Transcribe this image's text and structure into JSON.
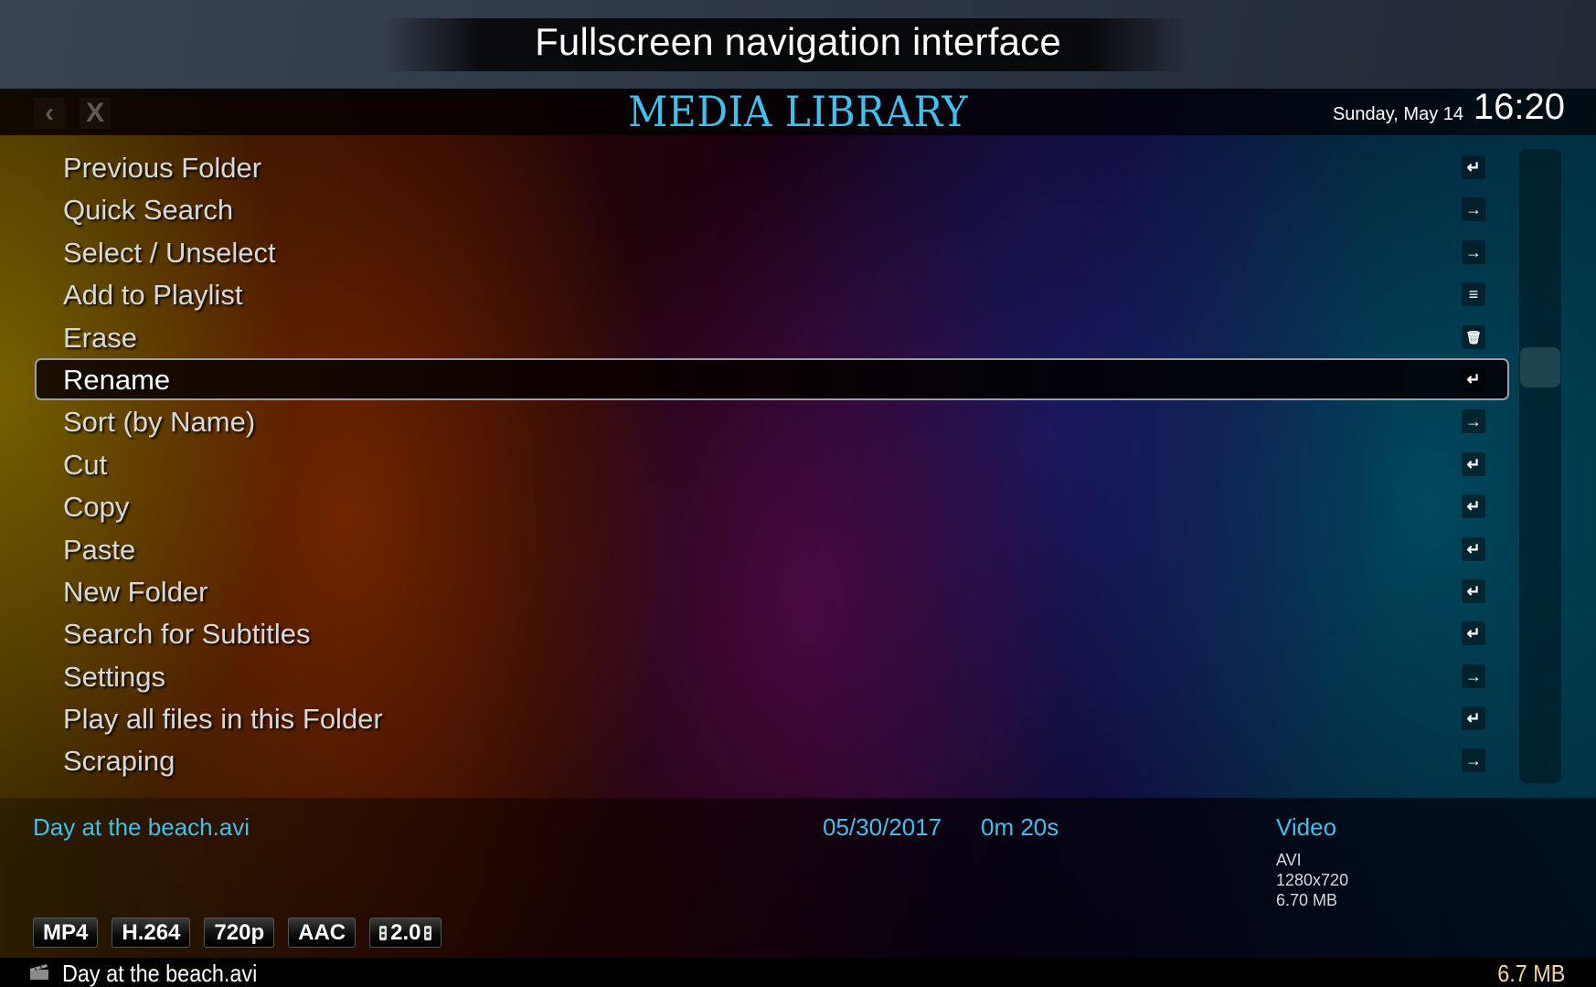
{
  "banner": {
    "caption": "Fullscreen navigation interface"
  },
  "header": {
    "back_icon": "chevron-left-icon",
    "back_glyph": "‹",
    "close_icon": "close-icon",
    "close_glyph": "X",
    "title": "MEDIA LIBRARY",
    "date": "Sunday, May 14",
    "time": "16:20"
  },
  "menu": {
    "selected_index": 5,
    "items": [
      {
        "label": "Previous Folder",
        "icon": "enter-icon",
        "glyph": "↵"
      },
      {
        "label": "Quick Search",
        "icon": "arrow-right-icon",
        "glyph": "→"
      },
      {
        "label": "Select / Unselect",
        "icon": "arrow-right-icon",
        "glyph": "→"
      },
      {
        "label": "Add to Playlist",
        "icon": "playlist-icon",
        "glyph": "≡"
      },
      {
        "label": "Erase",
        "icon": "trash-icon",
        "glyph": "🗑"
      },
      {
        "label": "Rename",
        "icon": "enter-icon",
        "glyph": "↵"
      },
      {
        "label": "Sort (by Name)",
        "icon": "arrow-right-icon",
        "glyph": "→"
      },
      {
        "label": "Cut",
        "icon": "enter-icon",
        "glyph": "↵"
      },
      {
        "label": "Copy",
        "icon": "enter-icon",
        "glyph": "↵"
      },
      {
        "label": "Paste",
        "icon": "enter-icon",
        "glyph": "↵"
      },
      {
        "label": "New Folder",
        "icon": "enter-icon",
        "glyph": "↵"
      },
      {
        "label": "Search for Subtitles",
        "icon": "enter-icon",
        "glyph": "↵"
      },
      {
        "label": "Settings",
        "icon": "arrow-right-icon",
        "glyph": "→"
      },
      {
        "label": "Play all files in this Folder",
        "icon": "enter-icon",
        "glyph": "↵"
      },
      {
        "label": "Scraping",
        "icon": "arrow-right-icon",
        "glyph": "→"
      }
    ]
  },
  "info": {
    "filename": "Day at the beach.avi",
    "date": "05/30/2017",
    "duration": "0m 20s",
    "type": "Video",
    "container": "AVI",
    "resolution": "1280x720",
    "filesize": "6.70 MB",
    "badges": [
      "MP4",
      "H.264",
      "720p",
      "AAC",
      "2.0"
    ]
  },
  "status": {
    "icon": "clapperboard-icon",
    "filename": "Day at the beach.avi",
    "size": "6.7 MB"
  },
  "colors": {
    "accent": "#42bfea",
    "size_text": "#f2d49a"
  }
}
